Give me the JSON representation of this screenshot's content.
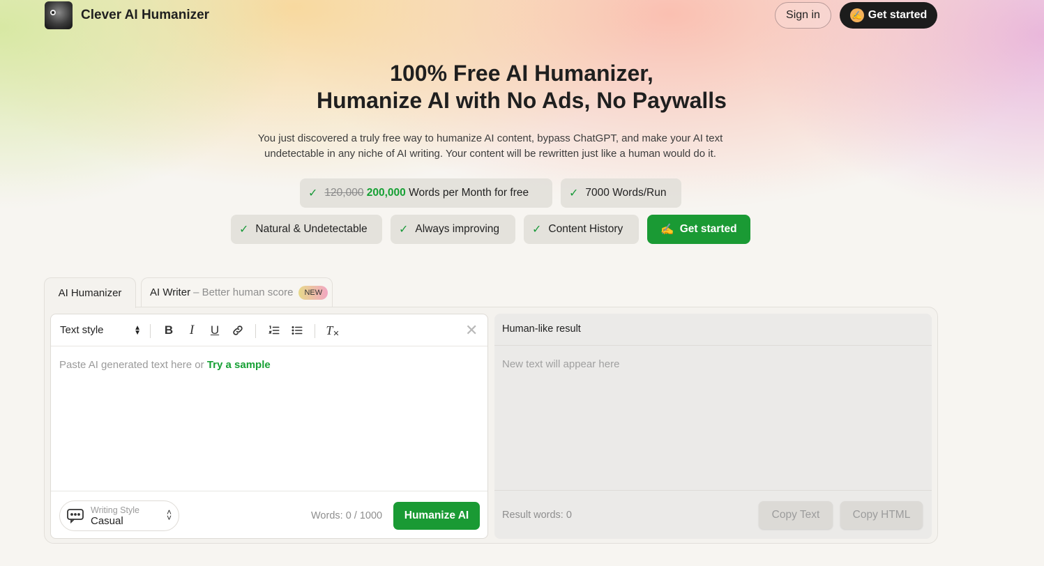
{
  "header": {
    "brand": "Clever AI Humanizer",
    "signin_label": "Sign in",
    "getstarted_label": "Get started"
  },
  "hero": {
    "title_line1": "100% Free AI Humanizer,",
    "title_line2": "Humanize AI with No Ads, No Paywalls",
    "subtitle_line1": "You just discovered a truly free way to humanize AI content, bypass ChatGPT, and make your AI text",
    "subtitle_line2": "undetectable in any niche of AI writing. Your content will be rewritten just like a human would do it.",
    "features": {
      "old_words": "120,000",
      "new_words": "200,000",
      "words_suffix": "Words per Month for free",
      "per_run": "7000 Words/Run",
      "natural": "Natural & Undetectable",
      "improving": "Always improving",
      "history": "Content History"
    },
    "cta_label": "Get started"
  },
  "tabs": {
    "humanizer": "AI Humanizer",
    "writer": "AI Writer",
    "writer_suffix": "– Better human score",
    "new_badge": "NEW"
  },
  "editor": {
    "text_style": "Text style",
    "placeholder": "Paste AI generated text here or",
    "sample_link": "Try a sample",
    "writing_style_caption": "Writing Style",
    "writing_style_value": "Casual",
    "word_count": "Words: 0 / 1000",
    "humanize_label": "Humanize AI"
  },
  "result": {
    "title": "Human-like result",
    "placeholder": "New text will appear here",
    "word_count": "Result words: 0",
    "copy_text_label": "Copy Text",
    "copy_html_label": "Copy HTML"
  },
  "colors": {
    "accent_green": "#1a9a34",
    "dark_button": "#1c1c1c"
  },
  "icons": {
    "check": "check-icon",
    "bold": "bold-icon",
    "italic": "italic-icon",
    "underline": "underline-icon",
    "link": "link-icon",
    "ordered_list": "ordered-list-icon",
    "bullet_list": "bullet-list-icon",
    "clear_format": "clear-format-icon",
    "close": "close-icon",
    "chat": "chat-bubble-icon"
  }
}
